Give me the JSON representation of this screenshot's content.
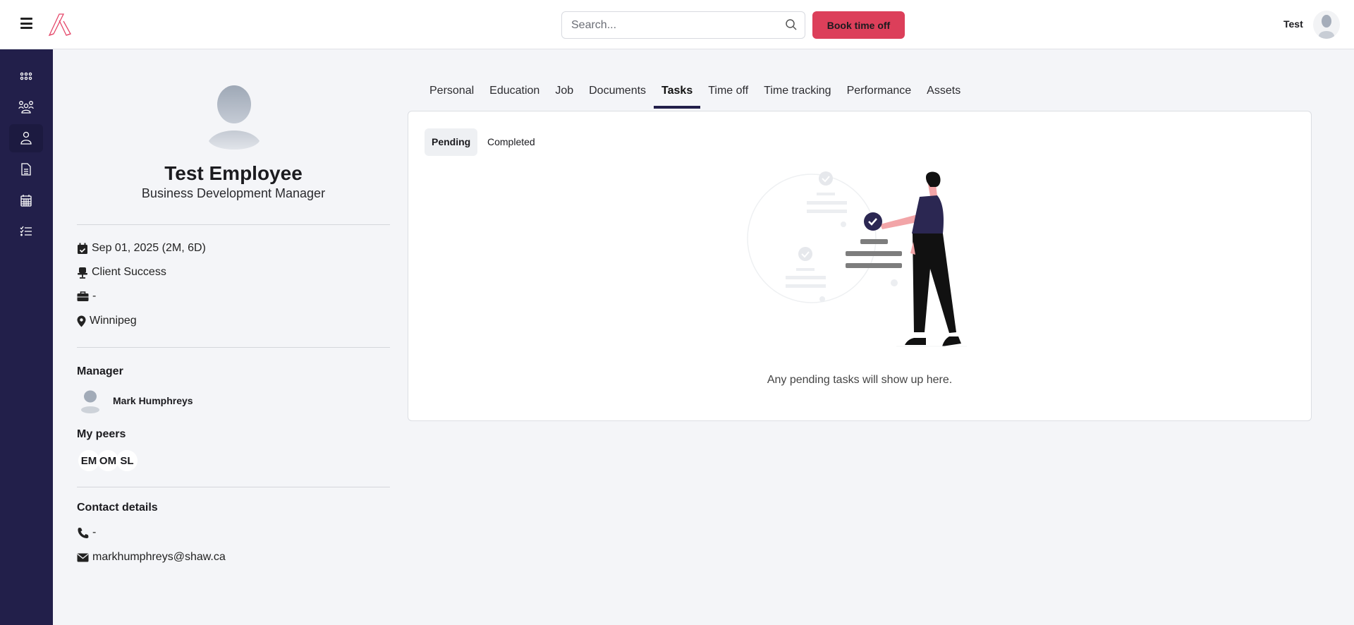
{
  "header": {
    "search_placeholder": "Search...",
    "book_button": "Book time off",
    "user_name": "Test"
  },
  "sidebar": {
    "items": [
      {
        "icon": "apps-icon"
      },
      {
        "icon": "team-icon"
      },
      {
        "icon": "person-icon",
        "active": true
      },
      {
        "icon": "document-icon"
      },
      {
        "icon": "calendar-icon"
      },
      {
        "icon": "checklist-icon"
      }
    ]
  },
  "profile": {
    "name": "Test Employee",
    "title": "Business Development Manager",
    "start_date": "Sep 01, 2025 (2M, 6D)",
    "department": "Client Success",
    "employment_type": "-",
    "location": "Winnipeg",
    "manager_heading": "Manager",
    "manager_name": "Mark Humphreys",
    "peers_heading": "My peers",
    "peers": [
      "EM",
      "OM",
      "SL"
    ],
    "contact_heading": "Contact details",
    "phone": "-",
    "email": "markhumphreys@shaw.ca"
  },
  "tabs": [
    "Personal",
    "Education",
    "Job",
    "Documents",
    "Tasks",
    "Time off",
    "Time tracking",
    "Performance",
    "Assets"
  ],
  "active_tab": "Tasks",
  "tasks": {
    "subtabs": [
      "Pending",
      "Completed"
    ],
    "active_subtab": "Pending",
    "empty_message": "Any pending tasks will show up here."
  },
  "colors": {
    "accent": "#dc3f5a",
    "sidebar": "#221f4a"
  }
}
